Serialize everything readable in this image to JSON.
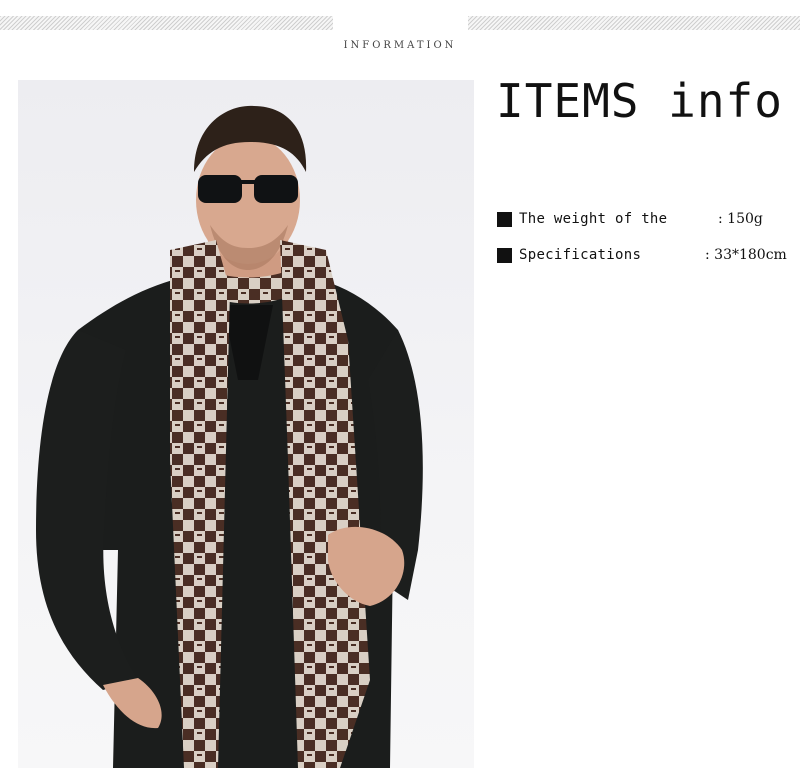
{
  "header": {
    "title": "INFORMATION"
  },
  "photo": {
    "subject": "man-wearing-checked-scarf",
    "background_color": "#efeff2",
    "sweater_color": "#1b1d1c",
    "scarf_colors": [
      "#4a2e24",
      "#d9cfc4"
    ]
  },
  "info": {
    "heading": "ITEMS info",
    "specs": [
      {
        "label": "The weight of the",
        "value": ": 150g"
      },
      {
        "label": "Specifications",
        "value": ": 33*180cm"
      }
    ]
  }
}
